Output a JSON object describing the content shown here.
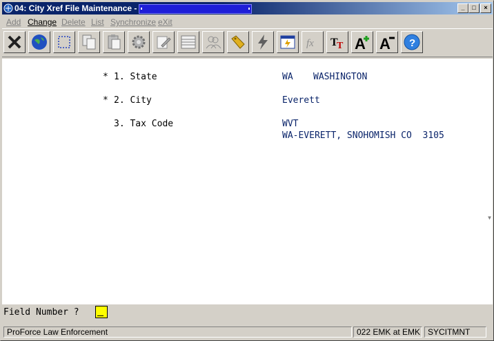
{
  "window": {
    "title": "04: City Xref File Maintenance -"
  },
  "menu": [
    {
      "label": "Add",
      "active": false
    },
    {
      "label": "Change",
      "active": true
    },
    {
      "label": "Delete",
      "active": false
    },
    {
      "label": "List",
      "active": false
    },
    {
      "label": "Synchronize",
      "active": false
    },
    {
      "label": "eXit",
      "active": false
    }
  ],
  "toolbar": [
    "close-x-icon",
    "globe-icon",
    "select-dotted-icon",
    "copy-icon",
    "paste-icon",
    "settings-gear-icon",
    "edit-pencil-icon",
    "table-icon",
    "users-icon",
    "tag-icon",
    "lightning-icon",
    "calendar-icon",
    "fx-icon",
    "font-style-icon",
    "font-increase-icon",
    "font-decrease-icon",
    "help-icon"
  ],
  "fields": {
    "state": {
      "marker": "*",
      "label": "1. State",
      "code": "WA",
      "name": "WASHINGTON"
    },
    "city": {
      "marker": "*",
      "label": "2. City",
      "value": "Everett"
    },
    "tax_code": {
      "label": "3. Tax Code",
      "code": "WVT",
      "desc": "WA-EVERETT, SNOHOMISH CO  3105"
    }
  },
  "prompt": {
    "label": "Field Number ?"
  },
  "status": {
    "agency": "ProForce Law Enforcement",
    "user": "022 EMK at EMK",
    "program": "SYCITMNT"
  },
  "colors": {
    "title_active": "#0a246a",
    "input_highlight": "#ffff00",
    "value_text": "#0a246a"
  }
}
